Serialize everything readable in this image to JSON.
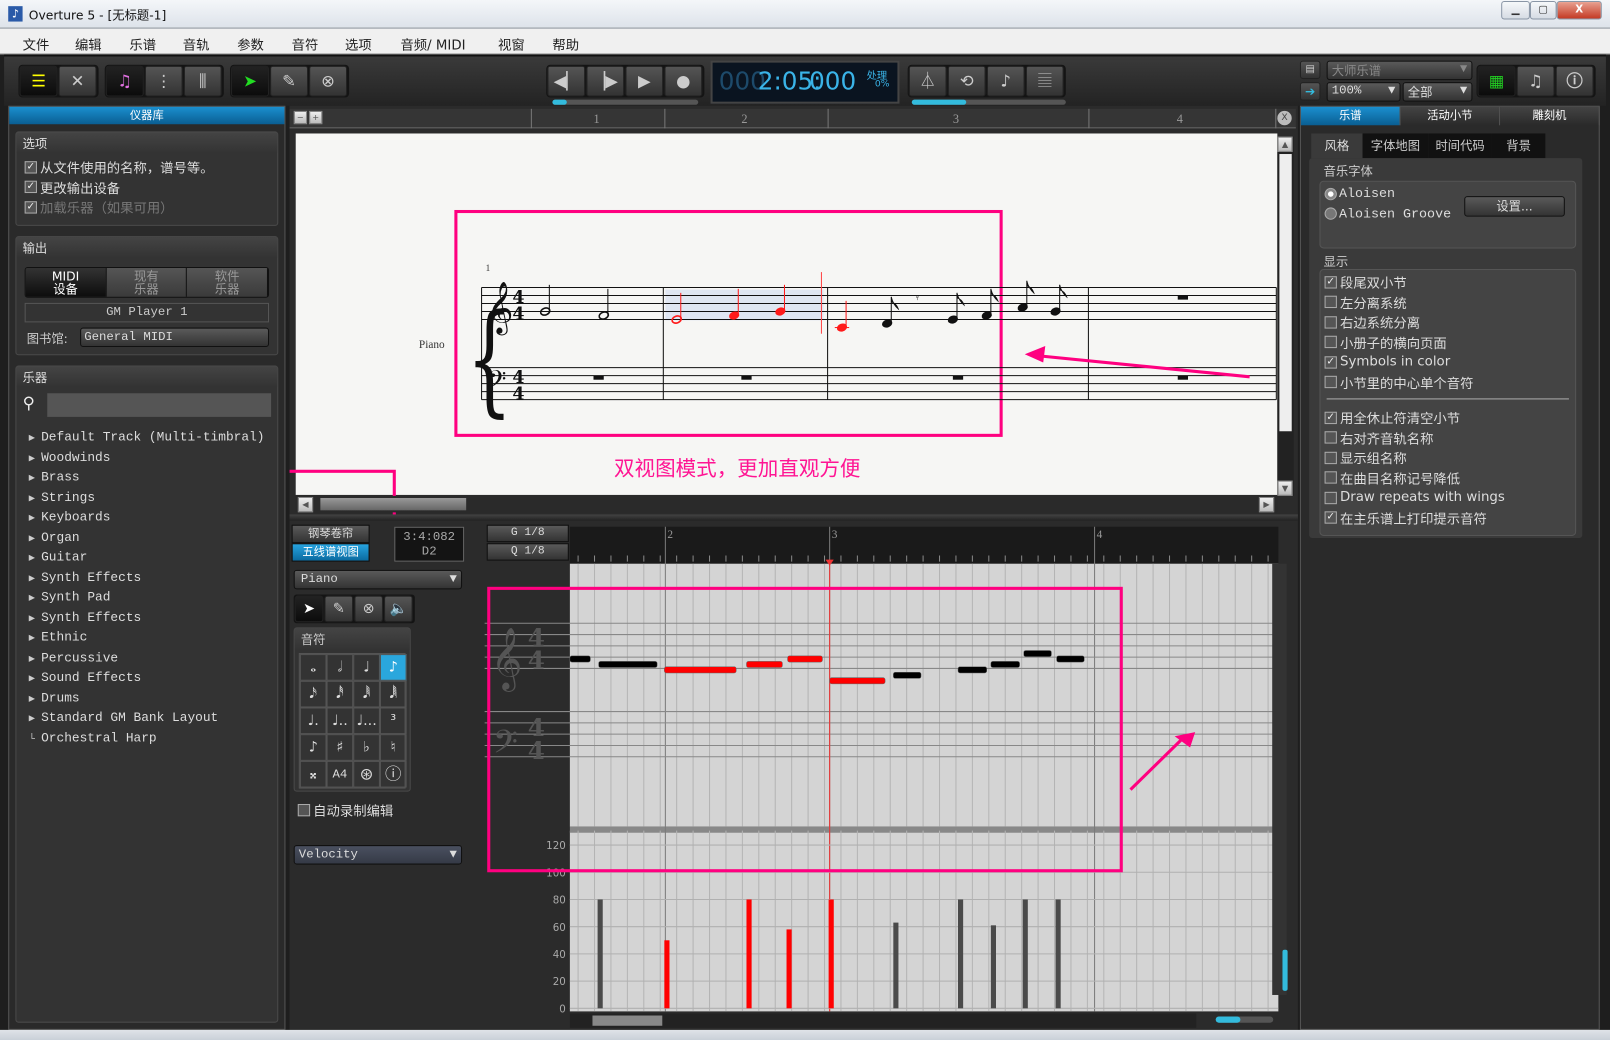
{
  "window": {
    "title": "Overture 5 - [无标题-1]",
    "controls": [
      "minimize",
      "maximize",
      "close"
    ]
  },
  "menu": [
    "文件",
    "编辑",
    "乐谱",
    "音轨",
    "参数",
    "音符",
    "选项",
    "音频/ MIDI",
    "视窗",
    "帮助"
  ],
  "toolbar": {
    "groups": [
      [
        "score-icon",
        "tools-icon"
      ],
      [
        "note-icon",
        "track-list-icon",
        "mixer-icon"
      ],
      [
        "select-arrow-icon",
        "pencil-icon",
        "erase-icon"
      ]
    ],
    "transport": [
      "rewind-icon",
      "step-icon",
      "play-icon",
      "record-icon"
    ],
    "time_dim": "000",
    "time": "2:05:",
    "ticks": "000",
    "processing": "处理",
    "processing_pct": "0%",
    "right_tools": [
      "metronome-icon",
      "loop-icon",
      "step-note-icon",
      "staff-icon"
    ],
    "tempo_slider": 0.35,
    "volume_slider": 0.1,
    "view_select": "大师乐谱",
    "zoom_select": "100%",
    "range_select": "全部"
  },
  "left": {
    "header": "仪器库",
    "options": {
      "title": "选项",
      "items": [
        {
          "label": "从文件使用的名称，谱号等。",
          "checked": true
        },
        {
          "label": "更改输出设备",
          "checked": true
        },
        {
          "label": "加载乐器（如果可用）",
          "checked": true,
          "disabled": true
        }
      ]
    },
    "output": {
      "title": "输出",
      "tabs": [
        [
          "MIDI",
          "设备"
        ],
        [
          "现有",
          "乐器"
        ],
        [
          "软件",
          "乐器"
        ]
      ],
      "device": "GM Player 1",
      "library_label": "图书馆:",
      "library": "General MIDI"
    },
    "instruments": {
      "title": "乐器",
      "search_placeholder": "",
      "items": [
        "Default Track (Multi-timbral)",
        "Woodwinds",
        "Brass",
        "Strings",
        "Keyboards",
        "Organ",
        "Guitar",
        "Synth Effects",
        "Synth Pad",
        "Synth Effects",
        "Ethnic",
        "Percussive",
        "Sound Effects",
        "Drums",
        "Standard GM Bank Layout",
        "Orchestral Harp"
      ]
    }
  },
  "score": {
    "measure_numbers": [
      "1",
      "2",
      "3",
      "4"
    ],
    "staff_label": "Piano",
    "first_measure": "1",
    "time_signature": [
      "4",
      "4"
    ],
    "annotation": "双视图模式，更加直观方便",
    "highlight_color": "#ff0080",
    "notes": [
      {
        "m": 1,
        "pitch": "G4",
        "dur": "half"
      },
      {
        "m": 1,
        "pitch": "F4",
        "dur": "half"
      },
      {
        "m": 2,
        "pitch": "E4",
        "dur": "half",
        "sel": true
      },
      {
        "m": 2,
        "pitch": "F4",
        "dur": "quarter",
        "sel": true
      },
      {
        "m": 2,
        "pitch": "G4",
        "dur": "quarter",
        "sel": true
      },
      {
        "m": 3,
        "pitch": "C4",
        "dur": "quarter",
        "sel": true
      },
      {
        "m": 3,
        "pitch": "D4",
        "dur": "eighth"
      },
      {
        "m": 3,
        "pitch": "rest",
        "dur": "eighth"
      },
      {
        "m": 3,
        "pitch": "E4",
        "dur": "eighth"
      },
      {
        "m": 3,
        "pitch": "F4",
        "dur": "eighth"
      },
      {
        "m": 3,
        "pitch": "A4",
        "dur": "eighth"
      },
      {
        "m": 3,
        "pitch": "G4",
        "dur": "eighth"
      }
    ]
  },
  "roll": {
    "view_tabs": [
      {
        "label": "钢琴卷帘",
        "active": false
      },
      {
        "label": "五线谱视图",
        "active": true
      }
    ],
    "position": "3:4:082",
    "pitch": "D2",
    "grid": "G 1/8",
    "quantize": "Q 1/8",
    "track": "Piano",
    "notes_title": "音符",
    "pitch_input": "A4",
    "auto_record": "自动录制编辑",
    "auto_record_checked": false,
    "controller": "Velocity",
    "ruler": [
      "2",
      "3",
      "4"
    ],
    "velocity_axis": [
      "120",
      "100",
      "80",
      "60",
      "40",
      "20",
      "0"
    ],
    "velocities": [
      80,
      50,
      80,
      58,
      80,
      63,
      80,
      61,
      80,
      80
    ],
    "selected": [
      false,
      true,
      true,
      true,
      true,
      false,
      false,
      false,
      false,
      false
    ],
    "selected_color": "#ff0000"
  },
  "right": {
    "tabs": [
      "乐谱",
      "活动小节",
      "雕刻机"
    ],
    "subtabs": [
      "风格",
      "字体地图",
      "时间代码",
      "背景"
    ],
    "font_group": "音乐字体",
    "fonts": [
      {
        "label": "Aloisen",
        "selected": true
      },
      {
        "label": "Aloisen Groove",
        "selected": false
      }
    ],
    "settings_button": "设置...",
    "display_group": "显示",
    "display": [
      {
        "label": "段尾双小节",
        "checked": true
      },
      {
        "label": "左分离系统",
        "checked": false
      },
      {
        "label": "右边系统分离",
        "checked": false
      },
      {
        "label": "小册子的横向页面",
        "checked": false
      },
      {
        "label": "Symbols in color",
        "checked": true
      },
      {
        "label": "小节里的中心单个音符",
        "checked": false
      }
    ],
    "display2": [
      {
        "label": "用全休止符清空小节",
        "checked": true
      },
      {
        "label": "右对齐音轨名称",
        "checked": false
      },
      {
        "label": "显示组名称",
        "checked": false
      },
      {
        "label": "在曲目名称记号降低",
        "checked": false
      },
      {
        "label": "Draw repeats with wings",
        "checked": false
      },
      {
        "label": "在主乐谱上打印提示音符",
        "checked": true
      }
    ]
  }
}
